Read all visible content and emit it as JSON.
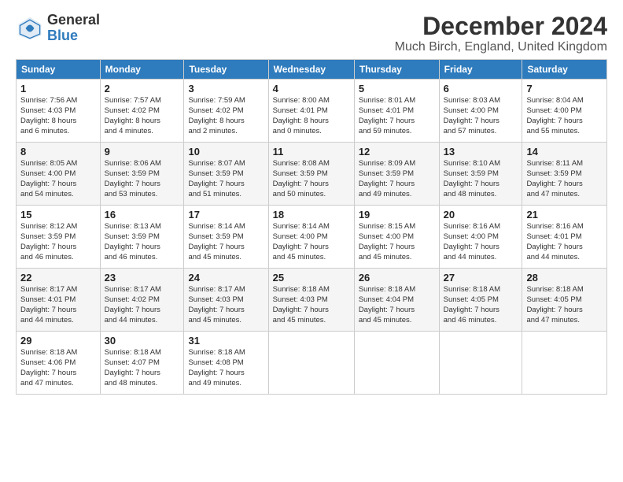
{
  "logo": {
    "line1": "General",
    "line2": "Blue"
  },
  "header": {
    "month": "December 2024",
    "location": "Much Birch, England, United Kingdom"
  },
  "weekdays": [
    "Sunday",
    "Monday",
    "Tuesday",
    "Wednesday",
    "Thursday",
    "Friday",
    "Saturday"
  ],
  "weeks": [
    [
      {
        "day": "1",
        "info": "Sunrise: 7:56 AM\nSunset: 4:03 PM\nDaylight: 8 hours\nand 6 minutes."
      },
      {
        "day": "2",
        "info": "Sunrise: 7:57 AM\nSunset: 4:02 PM\nDaylight: 8 hours\nand 4 minutes."
      },
      {
        "day": "3",
        "info": "Sunrise: 7:59 AM\nSunset: 4:02 PM\nDaylight: 8 hours\nand 2 minutes."
      },
      {
        "day": "4",
        "info": "Sunrise: 8:00 AM\nSunset: 4:01 PM\nDaylight: 8 hours\nand 0 minutes."
      },
      {
        "day": "5",
        "info": "Sunrise: 8:01 AM\nSunset: 4:01 PM\nDaylight: 7 hours\nand 59 minutes."
      },
      {
        "day": "6",
        "info": "Sunrise: 8:03 AM\nSunset: 4:00 PM\nDaylight: 7 hours\nand 57 minutes."
      },
      {
        "day": "7",
        "info": "Sunrise: 8:04 AM\nSunset: 4:00 PM\nDaylight: 7 hours\nand 55 minutes."
      }
    ],
    [
      {
        "day": "8",
        "info": "Sunrise: 8:05 AM\nSunset: 4:00 PM\nDaylight: 7 hours\nand 54 minutes."
      },
      {
        "day": "9",
        "info": "Sunrise: 8:06 AM\nSunset: 3:59 PM\nDaylight: 7 hours\nand 53 minutes."
      },
      {
        "day": "10",
        "info": "Sunrise: 8:07 AM\nSunset: 3:59 PM\nDaylight: 7 hours\nand 51 minutes."
      },
      {
        "day": "11",
        "info": "Sunrise: 8:08 AM\nSunset: 3:59 PM\nDaylight: 7 hours\nand 50 minutes."
      },
      {
        "day": "12",
        "info": "Sunrise: 8:09 AM\nSunset: 3:59 PM\nDaylight: 7 hours\nand 49 minutes."
      },
      {
        "day": "13",
        "info": "Sunrise: 8:10 AM\nSunset: 3:59 PM\nDaylight: 7 hours\nand 48 minutes."
      },
      {
        "day": "14",
        "info": "Sunrise: 8:11 AM\nSunset: 3:59 PM\nDaylight: 7 hours\nand 47 minutes."
      }
    ],
    [
      {
        "day": "15",
        "info": "Sunrise: 8:12 AM\nSunset: 3:59 PM\nDaylight: 7 hours\nand 46 minutes."
      },
      {
        "day": "16",
        "info": "Sunrise: 8:13 AM\nSunset: 3:59 PM\nDaylight: 7 hours\nand 46 minutes."
      },
      {
        "day": "17",
        "info": "Sunrise: 8:14 AM\nSunset: 3:59 PM\nDaylight: 7 hours\nand 45 minutes."
      },
      {
        "day": "18",
        "info": "Sunrise: 8:14 AM\nSunset: 4:00 PM\nDaylight: 7 hours\nand 45 minutes."
      },
      {
        "day": "19",
        "info": "Sunrise: 8:15 AM\nSunset: 4:00 PM\nDaylight: 7 hours\nand 45 minutes."
      },
      {
        "day": "20",
        "info": "Sunrise: 8:16 AM\nSunset: 4:00 PM\nDaylight: 7 hours\nand 44 minutes."
      },
      {
        "day": "21",
        "info": "Sunrise: 8:16 AM\nSunset: 4:01 PM\nDaylight: 7 hours\nand 44 minutes."
      }
    ],
    [
      {
        "day": "22",
        "info": "Sunrise: 8:17 AM\nSunset: 4:01 PM\nDaylight: 7 hours\nand 44 minutes."
      },
      {
        "day": "23",
        "info": "Sunrise: 8:17 AM\nSunset: 4:02 PM\nDaylight: 7 hours\nand 44 minutes."
      },
      {
        "day": "24",
        "info": "Sunrise: 8:17 AM\nSunset: 4:03 PM\nDaylight: 7 hours\nand 45 minutes."
      },
      {
        "day": "25",
        "info": "Sunrise: 8:18 AM\nSunset: 4:03 PM\nDaylight: 7 hours\nand 45 minutes."
      },
      {
        "day": "26",
        "info": "Sunrise: 8:18 AM\nSunset: 4:04 PM\nDaylight: 7 hours\nand 45 minutes."
      },
      {
        "day": "27",
        "info": "Sunrise: 8:18 AM\nSunset: 4:05 PM\nDaylight: 7 hours\nand 46 minutes."
      },
      {
        "day": "28",
        "info": "Sunrise: 8:18 AM\nSunset: 4:05 PM\nDaylight: 7 hours\nand 47 minutes."
      }
    ],
    [
      {
        "day": "29",
        "info": "Sunrise: 8:18 AM\nSunset: 4:06 PM\nDaylight: 7 hours\nand 47 minutes."
      },
      {
        "day": "30",
        "info": "Sunrise: 8:18 AM\nSunset: 4:07 PM\nDaylight: 7 hours\nand 48 minutes."
      },
      {
        "day": "31",
        "info": "Sunrise: 8:18 AM\nSunset: 4:08 PM\nDaylight: 7 hours\nand 49 minutes."
      },
      null,
      null,
      null,
      null
    ]
  ]
}
